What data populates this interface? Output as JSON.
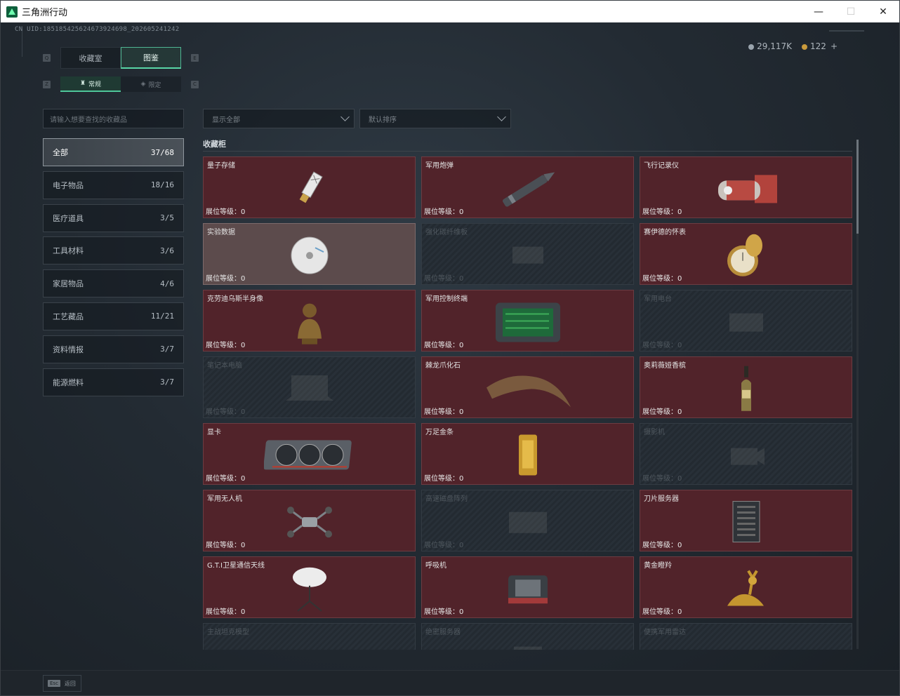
{
  "window": {
    "title": "三角洲行动",
    "controls": {
      "minimize": "—",
      "maximize": "☐",
      "close": "✕"
    }
  },
  "header": {
    "uid": "CN UID:1851854256246739246​98_202605241242",
    "currency": {
      "coins": "29,117K",
      "tokens": "122",
      "plus": "+"
    }
  },
  "tabs": {
    "left_key": "Q",
    "right_key": "E",
    "items": [
      {
        "label": "收藏室"
      },
      {
        "label": "图鉴"
      }
    ]
  },
  "subtabs": {
    "left_key": "Z",
    "right_key": "C",
    "items": [
      {
        "label": "常规"
      },
      {
        "label": "限定"
      }
    ]
  },
  "filters": {
    "search_placeholder": "请输入想要查找的收藏品",
    "display": "显示全部",
    "sort": "默认排序"
  },
  "categories": [
    {
      "label": "全部",
      "count": "37/68"
    },
    {
      "label": "电子物品",
      "count": "18/16"
    },
    {
      "label": "医疗道具",
      "count": "3/5"
    },
    {
      "label": "工具材料",
      "count": "3/6"
    },
    {
      "label": "家居物品",
      "count": "4/6"
    },
    {
      "label": "工艺藏品",
      "count": "11/21"
    },
    {
      "label": "资料情报",
      "count": "3/7"
    },
    {
      "label": "能源燃料",
      "count": "3/7"
    }
  ],
  "section": {
    "title": "收藏柜"
  },
  "level_prefix": "展位等级：",
  "items": [
    {
      "name": "量子存储",
      "level": "0",
      "state": "owned",
      "icon": "usb-drive-icon"
    },
    {
      "name": "军用炮弹",
      "level": "0",
      "state": "owned",
      "icon": "artillery-shell-icon"
    },
    {
      "name": "飞行记录仪",
      "level": "0",
      "state": "owned",
      "icon": "flight-recorder-icon"
    },
    {
      "name": "实验数据",
      "level": "0",
      "state": "owned-light",
      "icon": "data-disc-icon"
    },
    {
      "name": "强化碳纤维板",
      "level": "0",
      "state": "locked",
      "icon": "carbon-plate-icon"
    },
    {
      "name": "赛伊德的怀表",
      "level": "0",
      "state": "owned",
      "icon": "pocket-watch-icon"
    },
    {
      "name": "克劳迪乌斯半身像",
      "level": "0",
      "state": "owned",
      "icon": "bust-statue-icon"
    },
    {
      "name": "军用控制终端",
      "level": "0",
      "state": "owned",
      "icon": "control-terminal-icon"
    },
    {
      "name": "军用电台",
      "level": "0",
      "state": "locked",
      "icon": "radio-icon"
    },
    {
      "name": "笔记本电脑",
      "level": "0",
      "state": "locked",
      "icon": "laptop-icon"
    },
    {
      "name": "棘龙爪化石",
      "level": "0",
      "state": "owned",
      "icon": "claw-fossil-icon"
    },
    {
      "name": "奥莉薇娅香槟",
      "level": "0",
      "state": "owned",
      "icon": "champagne-bottle-icon"
    },
    {
      "name": "显卡",
      "level": "0",
      "state": "owned",
      "icon": "graphics-card-icon"
    },
    {
      "name": "万足金条",
      "level": "0",
      "state": "owned",
      "icon": "gold-bar-icon"
    },
    {
      "name": "摄影机",
      "level": "0",
      "state": "locked",
      "icon": "camera-icon"
    },
    {
      "name": "军用无人机",
      "level": "0",
      "state": "owned",
      "icon": "drone-icon"
    },
    {
      "name": "高速磁盘阵列",
      "level": "0",
      "state": "locked",
      "icon": "disk-array-icon"
    },
    {
      "name": "刀片服务器",
      "level": "0",
      "state": "owned",
      "icon": "blade-server-icon"
    },
    {
      "name": "G.T.I卫星通信天线",
      "level": "0",
      "state": "owned",
      "icon": "satellite-dish-icon"
    },
    {
      "name": "呼吸机",
      "level": "0",
      "state": "owned",
      "icon": "ventilator-icon"
    },
    {
      "name": "黄金瞪羚",
      "level": "0",
      "state": "owned",
      "icon": "gold-gazelle-icon"
    },
    {
      "name": "主战坦克模型",
      "level": "",
      "state": "locked",
      "icon": "tank-model-icon"
    },
    {
      "name": "绝密服务器",
      "level": "",
      "state": "locked",
      "icon": "server-icon"
    },
    {
      "name": "便携军用雷达",
      "level": "",
      "state": "locked",
      "icon": "radar-icon"
    }
  ],
  "footer": {
    "esc_key": "Esc",
    "back_label": "返回"
  },
  "colors": {
    "accent": "#4fc79a",
    "owned_card": "#51232a",
    "locked_card": "#262d34"
  }
}
